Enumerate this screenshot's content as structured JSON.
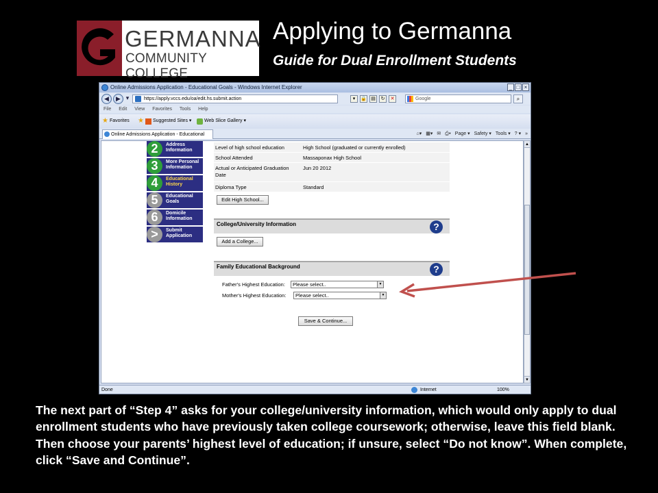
{
  "slide": {
    "logo_name": "GERMANNA",
    "logo_sub": "COMMUNITY COLLEGE",
    "title": "Applying to Germanna",
    "subtitle": "Guide for Dual Enrollment Students",
    "instructions": "The next part of “Step 4” asks for your college/university information, which would only apply to dual enrollment students who have previously taken college coursework; otherwise, leave this field blank. Then choose your parents’ highest level of education; if unsure, select “Do not know”. When complete, click “Save and Continue”."
  },
  "browser": {
    "window_title": "Online Admissions Application - Educational Goals - Windows Internet Explorer",
    "url": "https://apply.vccs.edu/oa/edit.hs.submit.action",
    "search_placeholder": "Google",
    "menu": [
      "File",
      "Edit",
      "View",
      "Favorites",
      "Tools",
      "Help"
    ],
    "favorites_label": "Favorites",
    "suggested_sites": "Suggested Sites ▾",
    "web_slice_gallery": "Web Slice Gallery ▾",
    "tab_title": "Online Admissions Application - Educational Goals",
    "commands": [
      "Page ▾",
      "Safety ▾",
      "Tools ▾",
      "? ▾"
    ],
    "status_left": "Done",
    "status_zone": "Internet",
    "zoom": "100%"
  },
  "steps": [
    {
      "num": "2",
      "label": "Address Information",
      "state": "green"
    },
    {
      "num": "3",
      "label": "More Personal Information",
      "state": "green"
    },
    {
      "num": "4",
      "label": "Educational History",
      "state": "active"
    },
    {
      "num": "5",
      "label": "Educational Goals",
      "state": "grey"
    },
    {
      "num": "6",
      "label": "Domicile Information",
      "state": "grey"
    },
    {
      "num": ">",
      "label": "Submit Application",
      "state": "grey"
    }
  ],
  "high_school": {
    "rows": [
      {
        "key": "Level of high school education",
        "value": "High School (graduated or currently enrolled)"
      },
      {
        "key": "School Attended",
        "value": "Massaponax High School"
      },
      {
        "key": "Actual or Anticipated Graduation Date",
        "value": "Jun 20 2012"
      },
      {
        "key": "Diploma Type",
        "value": "Standard"
      }
    ],
    "edit_button": "Edit High School..."
  },
  "college_section": {
    "title": "College/University Information",
    "add_button": "Add a College...",
    "help": "?"
  },
  "family_section": {
    "title": "Family Educational Background",
    "help": "?",
    "father_label": "Father's Highest Education:",
    "father_value": "Please select..",
    "mother_label": "Mother's Highest Education:",
    "mother_value": "Please select.."
  },
  "save_button": "Save & Continue...",
  "colors": {
    "logo_maroon": "#8a1e2a",
    "step_navy": "#2c2e82",
    "step_green": "#2f9e3a",
    "step_grey": "#9a9a9a",
    "help_blue": "#1f3d8c",
    "arrow_red": "#c0504d"
  }
}
